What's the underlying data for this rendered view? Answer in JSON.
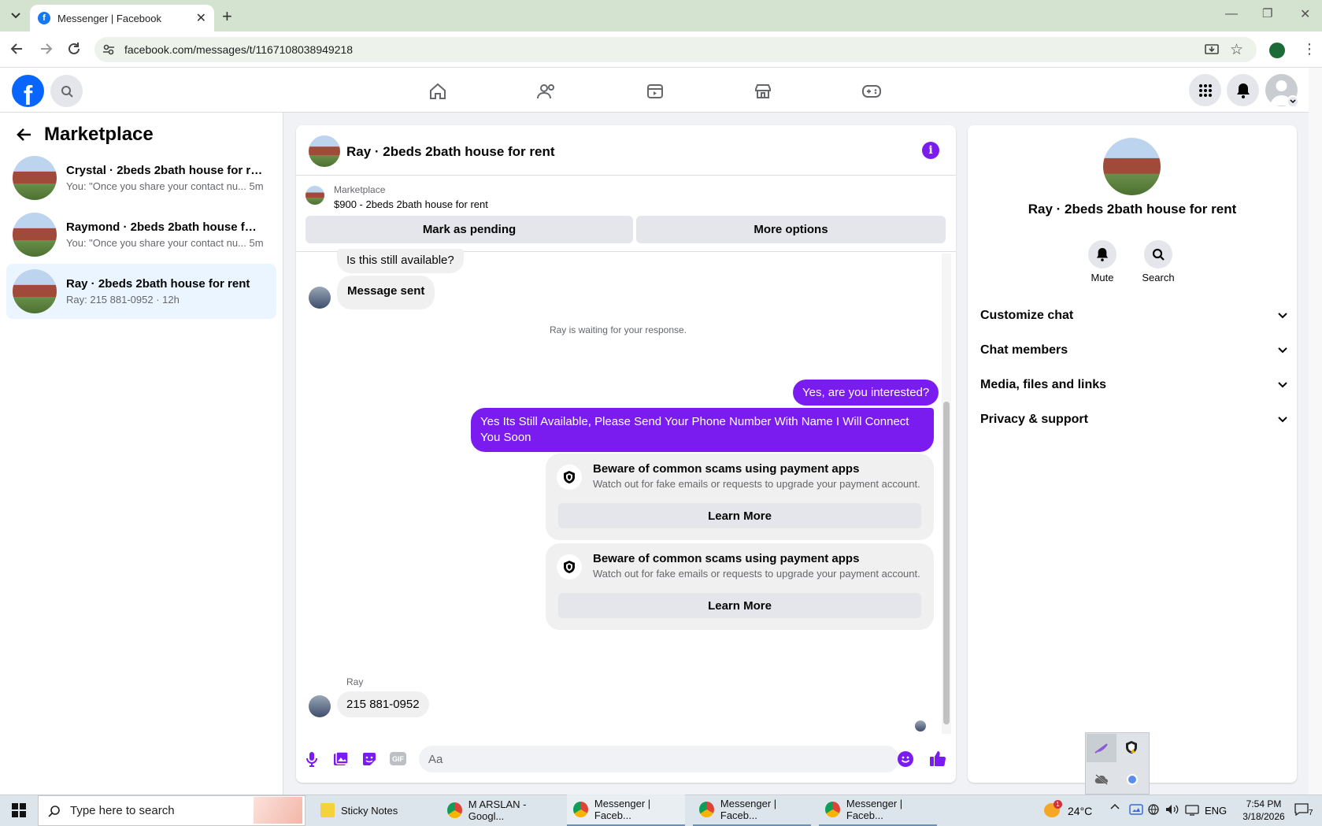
{
  "browser": {
    "tab_title": "Messenger | Facebook",
    "new_tab_symbol": "+",
    "url": "facebook.com/messages/t/1167108038949218"
  },
  "sidebar": {
    "title": "Marketplace",
    "conversations": [
      {
        "name": "Crystal · 2beds 2bath house for rent",
        "preview": "You: \"Once you share your contact nu...",
        "time": "5m"
      },
      {
        "name": "Raymond · 2beds 2bath house for ...",
        "preview": "You: \"Once you share your contact nu...",
        "time": "5m"
      },
      {
        "name": "Ray · 2beds 2bath house for rent",
        "preview": "Ray: 215 881-0952",
        "time": "12h"
      }
    ]
  },
  "chat": {
    "title": "Ray · 2beds 2bath house for rent",
    "listing": {
      "label": "Marketplace",
      "detail": "$900 - 2beds 2bath house for rent"
    },
    "mark_pending_label": "Mark as pending",
    "more_options_label": "More options",
    "messages": {
      "in_1": "Is this still available?",
      "in_2": "Message sent",
      "waiting": "Ray is waiting for your response.",
      "out_1": "Yes, are you interested?",
      "out_2": "Yes Its Still Available, Please Send Your Phone Number With Name I Will Connect You Soon",
      "scam_title": "Beware of common scams using payment apps",
      "scam_body": "Watch out for fake emails or requests to upgrade your payment account.",
      "learn_more": "Learn More",
      "sender": "Ray",
      "in_3": "215 881-0952"
    },
    "composer_placeholder": "Aa",
    "gif_label": "GIF"
  },
  "info_panel": {
    "title": "Ray · 2beds 2bath house for rent",
    "mute_label": "Mute",
    "search_label": "Search",
    "sections": [
      "Customize chat",
      "Chat members",
      "Media, files and links",
      "Privacy & support"
    ]
  },
  "taskbar": {
    "search_placeholder": "Type here to search",
    "apps": [
      "Sticky Notes",
      "M ARSLAN - Googl...",
      "Messenger | Faceb...",
      "Messenger | Faceb...",
      "Messenger | Faceb..."
    ],
    "weather": "24°C",
    "lang": "ENG",
    "time": "7:54 PM",
    "date": "3/18/2026",
    "weather_badge": "1",
    "notif_count": "7"
  },
  "colors": {
    "accent": "#7a1cf0",
    "facebook_blue": "#0866ff",
    "selected": "#ebf5ff"
  }
}
